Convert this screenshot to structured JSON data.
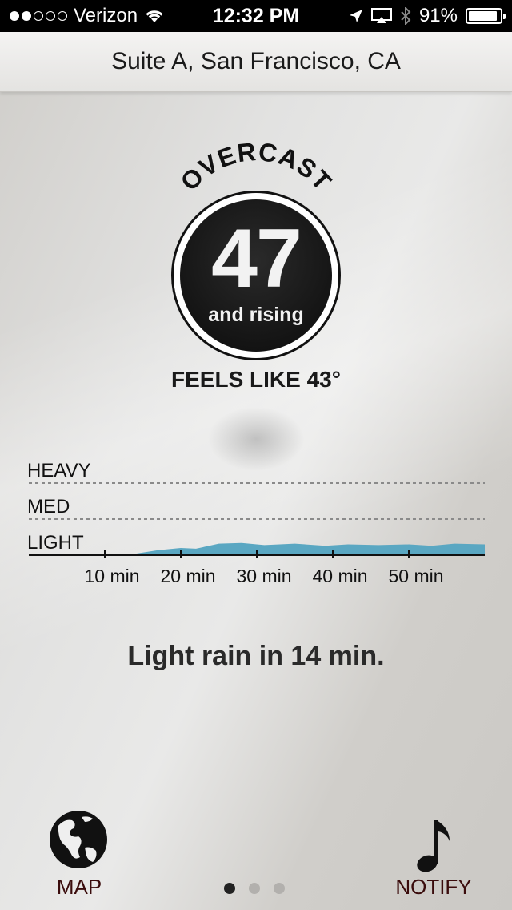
{
  "status_bar": {
    "carrier": "Verizon",
    "time": "12:32 PM",
    "battery_percent": "91%",
    "battery_level": 0.91,
    "signal_bars_filled": 2,
    "signal_bars_total": 5,
    "icons": [
      "wifi-icon",
      "location-arrow-icon",
      "airplay-icon",
      "bluetooth-icon",
      "battery-icon"
    ]
  },
  "header": {
    "location": "Suite A, San Francisco, CA"
  },
  "weather": {
    "condition": "OVERCAST",
    "temperature": "47",
    "trend": "and rising",
    "feels_like": "FEELS LIKE 43°"
  },
  "chart_data": {
    "type": "area",
    "y_categories": [
      "LIGHT",
      "MED",
      "HEAVY"
    ],
    "tick_labels": [
      "10 min",
      "20 min",
      "30 min",
      "40 min",
      "50 min"
    ],
    "tick_minutes": [
      10,
      20,
      30,
      40,
      50
    ],
    "x_range": [
      0,
      60
    ],
    "precip_intensity": [
      {
        "x": 0,
        "y": 0
      },
      {
        "x": 5,
        "y": 0
      },
      {
        "x": 10,
        "y": 0
      },
      {
        "x": 14,
        "y": 0.02
      },
      {
        "x": 17,
        "y": 0.07
      },
      {
        "x": 20,
        "y": 0.1
      },
      {
        "x": 22,
        "y": 0.09
      },
      {
        "x": 25,
        "y": 0.16
      },
      {
        "x": 28,
        "y": 0.17
      },
      {
        "x": 31,
        "y": 0.14
      },
      {
        "x": 35,
        "y": 0.16
      },
      {
        "x": 39,
        "y": 0.13
      },
      {
        "x": 42,
        "y": 0.15
      },
      {
        "x": 46,
        "y": 0.14
      },
      {
        "x": 50,
        "y": 0.15
      },
      {
        "x": 53,
        "y": 0.13
      },
      {
        "x": 56,
        "y": 0.16
      },
      {
        "x": 60,
        "y": 0.15
      }
    ],
    "fill_color": "#5aa7c2"
  },
  "forecast": {
    "summary": "Light rain in 14 min."
  },
  "bottom_bar": {
    "map_label": "MAP",
    "notify_label": "NOTIFY",
    "page_count": 3,
    "active_page": 0
  }
}
